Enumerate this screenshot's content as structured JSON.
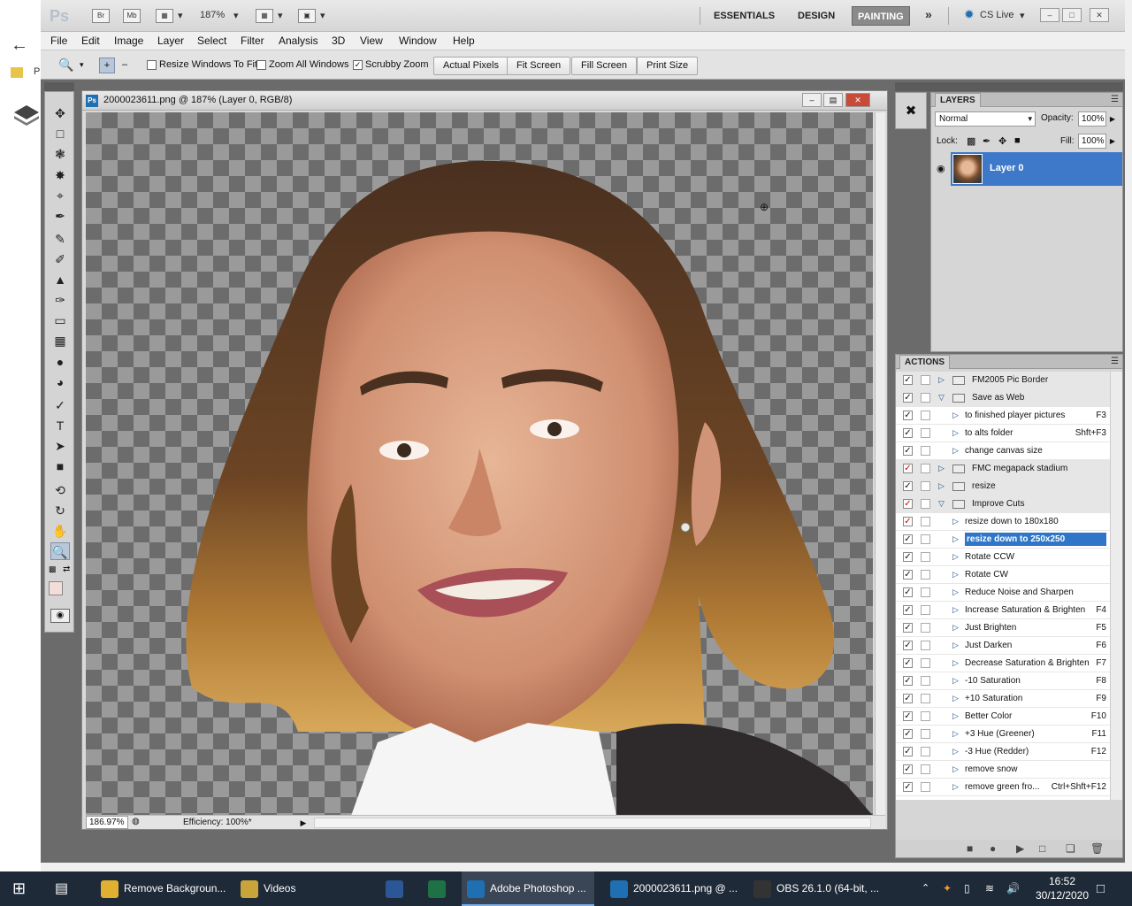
{
  "background": {
    "folder_label": "P"
  },
  "app": {
    "logo": "Ps",
    "bridge_button": "Br",
    "minibridge_button": "Mb",
    "zoom_level": "187%",
    "workspaces": [
      "ESSENTIALS",
      "DESIGN",
      "PAINTING"
    ],
    "active_workspace": "PAINTING",
    "cs_live": "CS Live"
  },
  "menu": [
    "File",
    "Edit",
    "Image",
    "Layer",
    "Select",
    "Filter",
    "Analysis",
    "3D",
    "View",
    "Window",
    "Help"
  ],
  "options": {
    "resize_windows": "Resize Windows To Fit",
    "zoom_all_windows": "Zoom All Windows",
    "scrubby_zoom": "Scrubby Zoom",
    "actual_pixels": "Actual Pixels",
    "fit_screen": "Fit Screen",
    "fill_screen": "Fill Screen",
    "print_size": "Print Size"
  },
  "document": {
    "badge": "Ps",
    "title": "2000023611.png @ 187% (Layer 0, RGB/8)",
    "zoom": "186.97%",
    "efficiency": "Efficiency: 100%*"
  },
  "layers_panel": {
    "tab": "LAYERS",
    "blend_mode": "Normal",
    "opacity_label": "Opacity:",
    "opacity": "100%",
    "lock_label": "Lock:",
    "fill_label": "Fill:",
    "fill": "100%",
    "layer_name": "Layer 0"
  },
  "actions_panel": {
    "tab": "ACTIONS",
    "rows": [
      {
        "name": "FM2005 Pic Border",
        "key": "",
        "type": "set",
        "open": false,
        "red": false
      },
      {
        "name": "Save as Web",
        "key": "",
        "type": "set",
        "open": true,
        "red": false
      },
      {
        "name": "to finished player pictures",
        "key": "F3",
        "type": "action",
        "red": false
      },
      {
        "name": "to alts folder",
        "key": "Shft+F3",
        "type": "action",
        "red": false
      },
      {
        "name": "change canvas size",
        "key": "",
        "type": "action",
        "red": false
      },
      {
        "name": "FMC megapack stadium",
        "key": "",
        "type": "set",
        "open": false,
        "red": true
      },
      {
        "name": "resize",
        "key": "",
        "type": "set",
        "open": false,
        "red": false
      },
      {
        "name": "Improve Cuts",
        "key": "",
        "type": "set",
        "open": true,
        "red": true
      },
      {
        "name": "resize down to 180x180",
        "key": "",
        "type": "action",
        "red": true
      },
      {
        "name": "resize down to 250x250",
        "key": "",
        "type": "action",
        "red": false,
        "selected": true
      },
      {
        "name": "Rotate CCW",
        "key": "",
        "type": "action",
        "red": false
      },
      {
        "name": "Rotate CW",
        "key": "",
        "type": "action",
        "red": false
      },
      {
        "name": "Reduce Noise and Sharpen",
        "key": "",
        "type": "action",
        "red": false
      },
      {
        "name": "Increase Saturation & Brighten",
        "key": "F4",
        "type": "action",
        "red": false
      },
      {
        "name": "Just Brighten",
        "key": "F5",
        "type": "action",
        "red": false
      },
      {
        "name": "Just Darken",
        "key": "F6",
        "type": "action",
        "red": false
      },
      {
        "name": "Decrease Saturation & Brighten",
        "key": "F7",
        "type": "action",
        "red": false
      },
      {
        "name": "-10 Saturation",
        "key": "F8",
        "type": "action",
        "red": false
      },
      {
        "name": "+10 Saturation",
        "key": "F9",
        "type": "action",
        "red": false
      },
      {
        "name": "Better Color",
        "key": "F10",
        "type": "action",
        "red": false
      },
      {
        "name": "+3 Hue (Greener)",
        "key": "F11",
        "type": "action",
        "red": false
      },
      {
        "name": "-3 Hue (Redder)",
        "key": "F12",
        "type": "action",
        "red": false
      },
      {
        "name": "remove snow",
        "key": "",
        "type": "action",
        "red": false
      },
      {
        "name": "remove green fro...",
        "key": "Ctrl+Shft+F12",
        "type": "action",
        "red": false
      }
    ]
  },
  "taskbar": {
    "items": [
      {
        "label": "Remove Backgroun...",
        "icon": "chrome-icon",
        "color": "#e0b030"
      },
      {
        "label": "Videos",
        "icon": "folder-icon",
        "color": "#c9a43a"
      },
      {
        "label": "",
        "icon": "word-icon",
        "color": "#2b5797"
      },
      {
        "label": "",
        "icon": "excel-icon",
        "color": "#1e7145"
      },
      {
        "label": "Adobe Photoshop ...",
        "icon": "photoshop-icon",
        "color": "#1f6fb3",
        "active": true
      },
      {
        "label": "2000023611.png @ ...",
        "icon": "photoshop-icon",
        "color": "#1f6fb3"
      },
      {
        "label": "OBS 26.1.0 (64-bit, ...",
        "icon": "obs-icon",
        "color": "#333"
      }
    ],
    "time": "16:52",
    "date": "30/12/2020"
  },
  "colors": {
    "selection": "#3d79c8",
    "workspace_active": "#8a8a8a",
    "taskbar": "#1f2a38"
  }
}
